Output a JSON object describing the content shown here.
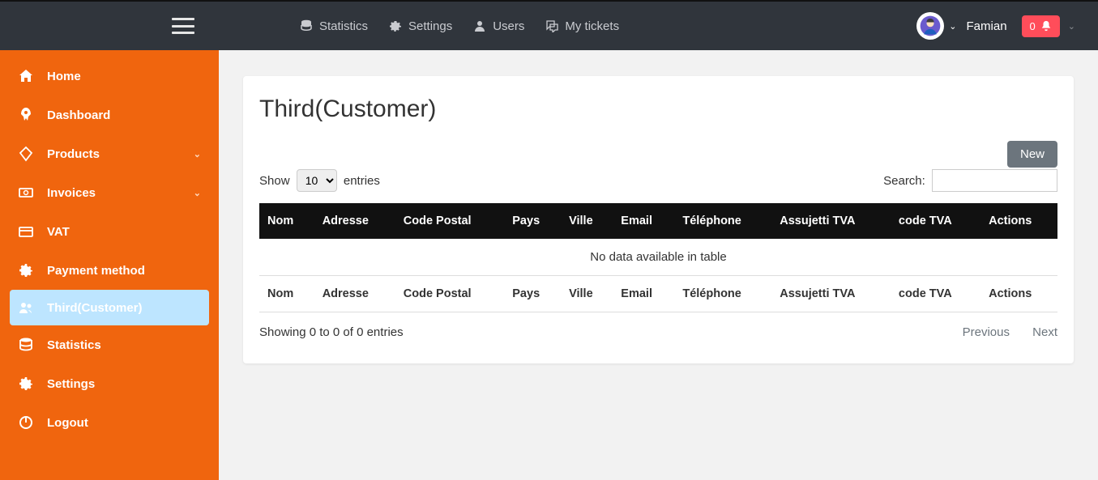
{
  "topnav": {
    "statistics": "Statistics",
    "settings": "Settings",
    "users": "Users",
    "mytickets": "My tickets"
  },
  "user": {
    "name": "Famian",
    "notif_count": "0"
  },
  "sidebar": {
    "items": [
      {
        "label": "Home",
        "icon": "home"
      },
      {
        "label": "Dashboard",
        "icon": "rocket"
      },
      {
        "label": "Products",
        "icon": "diamond",
        "chev": true
      },
      {
        "label": "Invoices",
        "icon": "money",
        "chev": true
      },
      {
        "label": "VAT",
        "icon": "card"
      },
      {
        "label": "Payment method",
        "icon": "gear"
      },
      {
        "label": "Third(Customer)",
        "icon": "users",
        "active": true
      },
      {
        "label": "Statistics",
        "icon": "db"
      },
      {
        "label": "Settings",
        "icon": "gear"
      },
      {
        "label": "Logout",
        "icon": "power"
      }
    ]
  },
  "page": {
    "title": "Third(Customer)",
    "new_btn": "New",
    "show_label": "Show",
    "entries_label": "entries",
    "length_value": "10",
    "search_label": "Search:",
    "columns": [
      "Nom",
      "Adresse",
      "Code Postal",
      "Pays",
      "Ville",
      "Email",
      "Téléphone",
      "Assujetti TVA",
      "code TVA",
      "Actions"
    ],
    "empty_msg": "No data available in table",
    "info": "Showing 0 to 0 of 0 entries",
    "prev": "Previous",
    "next": "Next"
  }
}
